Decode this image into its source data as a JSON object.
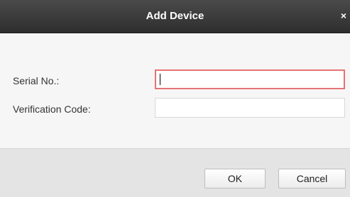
{
  "dialog": {
    "title": "Add Device",
    "close_glyph": "×"
  },
  "form": {
    "serial": {
      "label": "Serial No.:",
      "value": "",
      "focused": true
    },
    "verification": {
      "label": "Verification Code:",
      "value": ""
    }
  },
  "buttons": {
    "ok_label": "OK",
    "cancel_label": "Cancel"
  },
  "colors": {
    "titlebar": "#3a3a3a",
    "focus_border": "#e57373"
  },
  "icons": {
    "close": "close-icon"
  }
}
